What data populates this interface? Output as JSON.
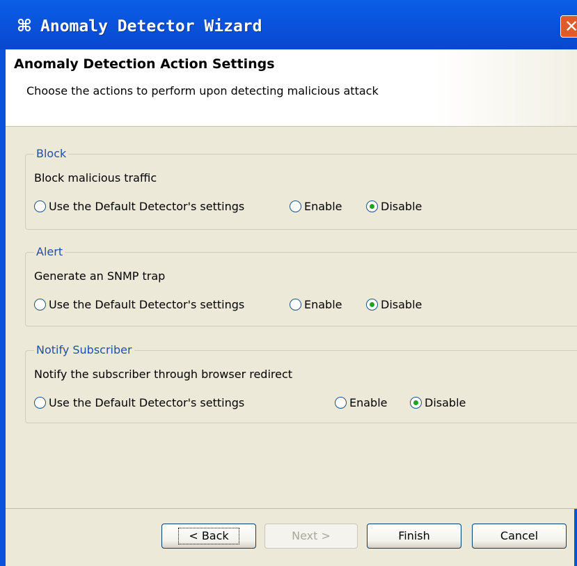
{
  "window": {
    "title": "Anomaly Detector Wizard",
    "icon": "cluster-icon",
    "close_label": "✕"
  },
  "header": {
    "title": "Anomaly Detection Action Settings",
    "subtitle": "Choose the actions to perform upon detecting malicious attack"
  },
  "groups": [
    {
      "title": "Block",
      "description": "Block malicious traffic",
      "options": [
        "Use the Default Detector's settings",
        "Enable",
        "Disable"
      ],
      "selected": "Disable"
    },
    {
      "title": "Alert",
      "description": "Generate an SNMP trap",
      "options": [
        "Use the Default Detector's settings",
        "Enable",
        "Disable"
      ],
      "selected": "Disable"
    },
    {
      "title": "Notify Subscriber",
      "description": "Notify the subscriber through browser redirect",
      "options": [
        "Use the Default Detector's settings",
        "Enable",
        "Disable"
      ],
      "selected": "Disable"
    }
  ],
  "buttons": {
    "back": "< Back",
    "next": "Next >",
    "finish": "Finish",
    "cancel": "Cancel"
  },
  "colors": {
    "titlebar": "#0a52dc",
    "group_title": "#1f4fa8",
    "radio_selected": "#21a121"
  }
}
